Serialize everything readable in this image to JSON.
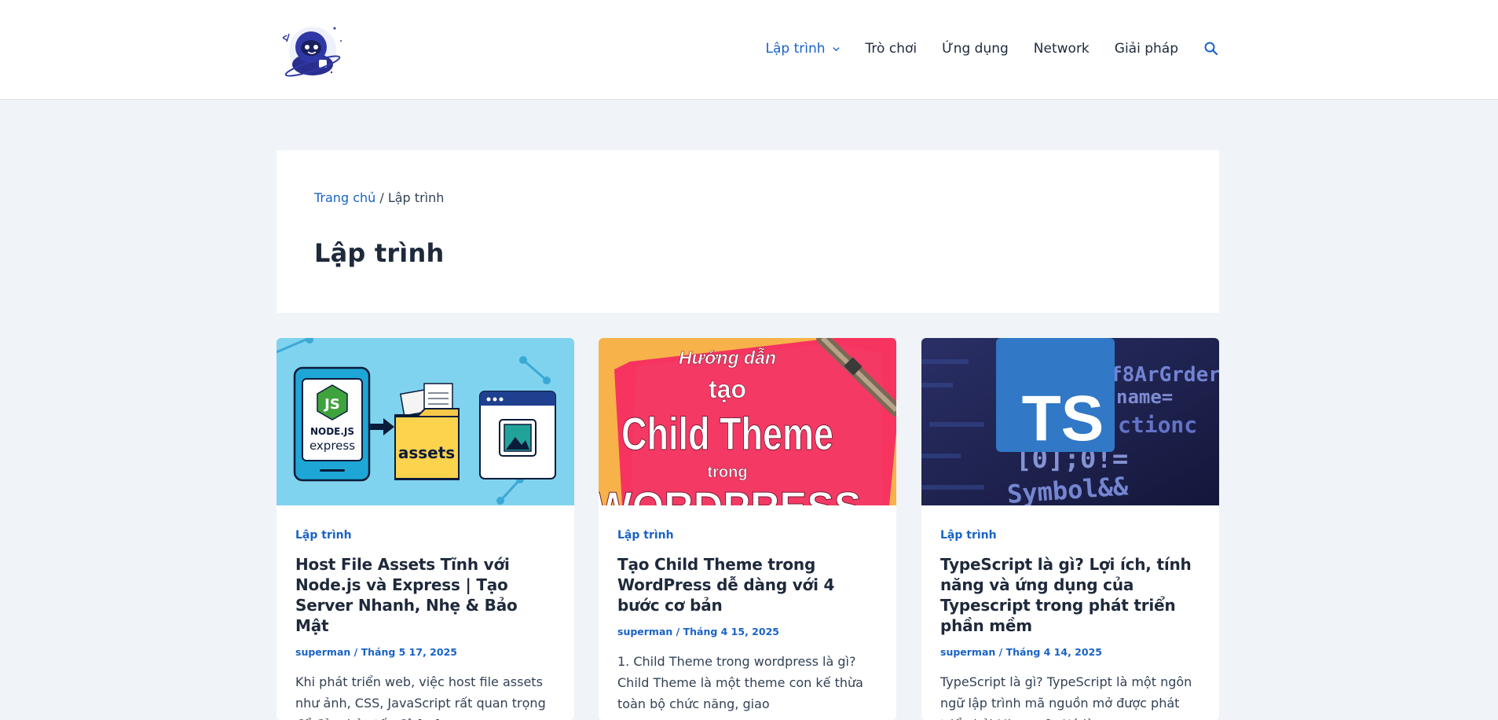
{
  "header": {
    "nav": [
      {
        "label": "Lập trình",
        "active": true,
        "has_dropdown": true
      },
      {
        "label": "Trò chơi"
      },
      {
        "label": "Ứng dụng"
      },
      {
        "label": "Network"
      },
      {
        "label": "Giải pháp"
      }
    ],
    "icons": {
      "search": "search-icon",
      "dropdown": "chevron-down-icon"
    }
  },
  "archive": {
    "breadcrumb": {
      "home": "Trang chủ",
      "separator": " / ",
      "current": "Lập trình"
    },
    "title": "Lập trình"
  },
  "posts": [
    {
      "category": "Lập trình",
      "title": "Host File Assets Tĩnh với Node.js và Express | Tạo Server Nhanh, Nhẹ & Bảo Mật",
      "author": "superman",
      "date": "Tháng 5 17, 2025",
      "excerpt": "Khi phát triển web, việc host file assets như ảnh, CSS, JavaScript rất quan trọng để đảm bảo tốc độ […]",
      "thumb": {
        "node_label": "NODE.JS",
        "express_label": "express",
        "folder_label": "assets",
        "js_label": "JS"
      }
    },
    {
      "category": "Lập trình",
      "title": "Tạo Child Theme trong WordPress dễ dàng với 4 bước cơ bản",
      "author": "superman",
      "date": "Tháng 4 15, 2025",
      "excerpt": "1. Child Theme trong wordpress là gì? Child Theme là một theme con kế thừa toàn bộ chức năng, giao",
      "thumb": {
        "line1": "Hướng dẫn",
        "line2": "tạo",
        "line3": "Child Theme",
        "line4": "trong",
        "line5": "WORDPRESS"
      }
    },
    {
      "category": "Lập trình",
      "title": "TypeScript là gì? Lợi ích, tính năng và ứng dụng của Typescript trong phát triển phần mềm",
      "author": "superman",
      "date": "Tháng 4 14, 2025",
      "excerpt": "TypeScript là gì? TypeScript là một ngôn ngữ lập trình mã nguồn mở được phát triển bởi Microsoft. Nó là",
      "thumb": {
        "badge": "TS",
        "code1": "f8ArGrder",
        "code2": "name=",
        "code3": "ctionc",
        "code4": "[0];0!=",
        "code5": "Symbol&&"
      }
    }
  ],
  "meta_separator": " / ",
  "colors": {
    "accent": "#1a63c6",
    "text": "#1e293b",
    "page_bg": "#f0f4f8",
    "card_bg": "#ffffff"
  }
}
